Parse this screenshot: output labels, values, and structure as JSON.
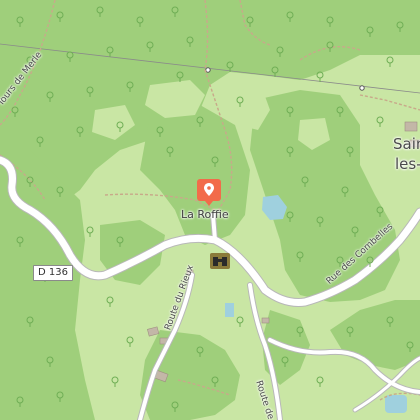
{
  "map": {
    "colors": {
      "land": "#c9e6a4",
      "forest": "#9fcf7b",
      "road": "#ffffff",
      "road_casing": "#b8b8b8",
      "trail": "#c8a98a",
      "water": "#9fd0de",
      "powerline": "#8a8a8a",
      "building": "#c3b7a7",
      "marker": "#f26b4a"
    },
    "labels": {
      "la_roffie": "La Roffie",
      "saint_top": "Sain",
      "saint_bottom": "les-",
      "road_number": "D 136",
      "rue_combelles": "Rue des Combelles",
      "route_rieux": "Route du Rieux",
      "route_f": "Route de F",
      "tours_merle": "Tours de Merle"
    },
    "icons": {
      "poi_marker": "map-pin-icon",
      "viewpoint": "binoculars-icon"
    }
  }
}
